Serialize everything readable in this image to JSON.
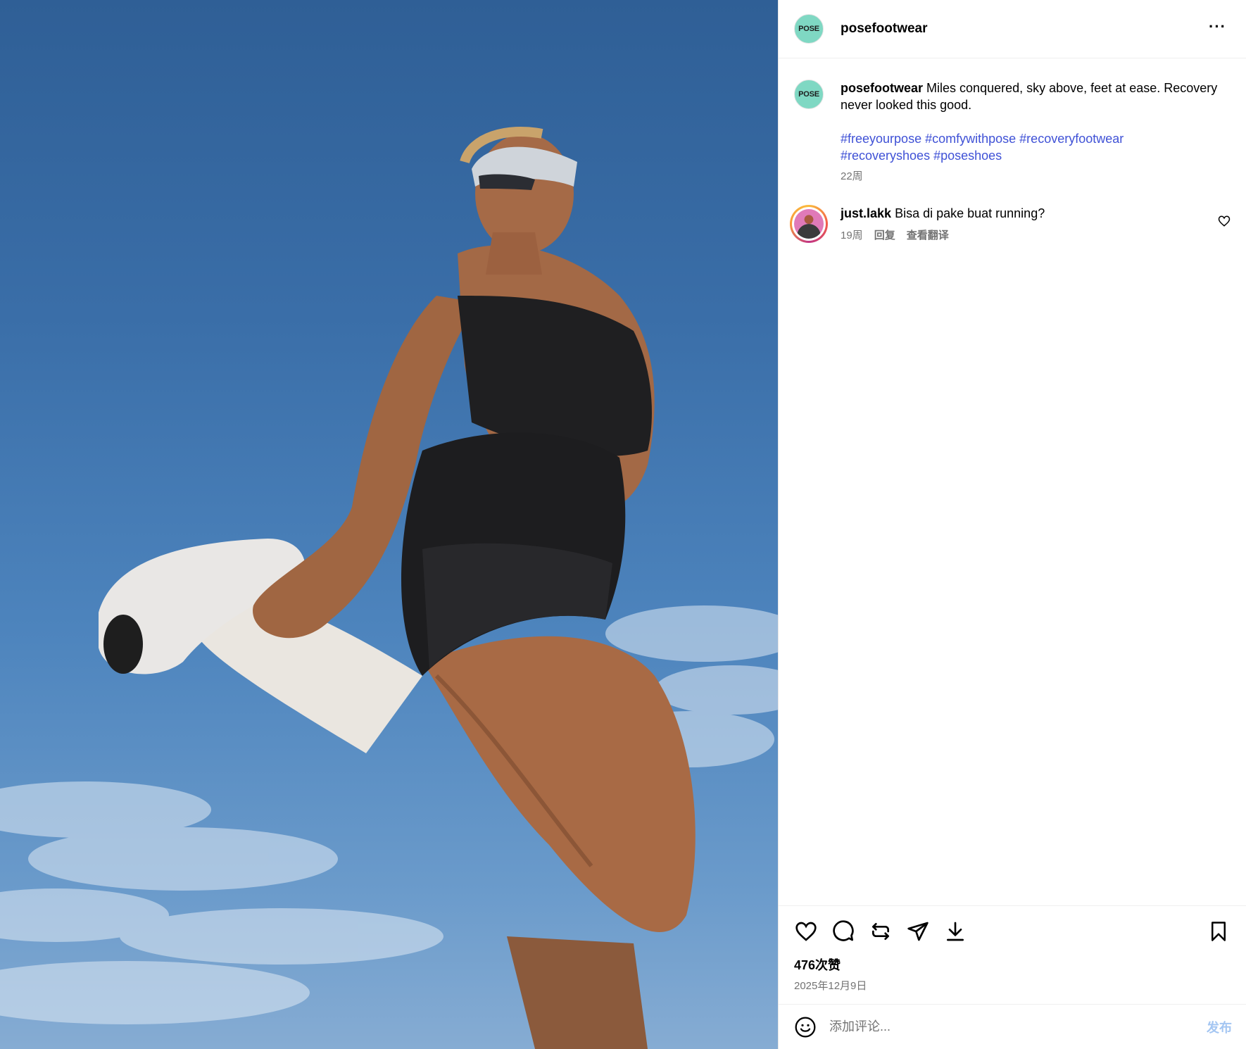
{
  "post": {
    "author": "posefootwear",
    "avatar_text": "POSE",
    "more_label": "···"
  },
  "caption": {
    "username": "posefootwear",
    "text": "Miles conquered, sky above, feet at ease. Recovery never looked this good.",
    "hashtags": [
      "#freeyourpose",
      "#comfywithpose",
      "#recoveryfootwear",
      "#recoveryshoes",
      "#poseshoes"
    ],
    "time": "22周"
  },
  "comments": [
    {
      "username": "just.lakk",
      "text": "Bisa di pake buat running?",
      "time": "19周",
      "reply_label": "回复",
      "translate_label": "查看翻译"
    }
  ],
  "actions": {
    "icons": [
      "heart-icon",
      "comment-icon",
      "repost-icon",
      "share-icon",
      "download-icon",
      "bookmark-icon"
    ]
  },
  "stats": {
    "likes": "476次赞",
    "date": "2025年12月9日"
  },
  "composer": {
    "placeholder": "添加评论...",
    "post_label": "发布"
  },
  "colors": {
    "hashtag": "#3f51d6",
    "avatar_bg": "#7fd8c3",
    "post_button": "#a4c6f2"
  }
}
